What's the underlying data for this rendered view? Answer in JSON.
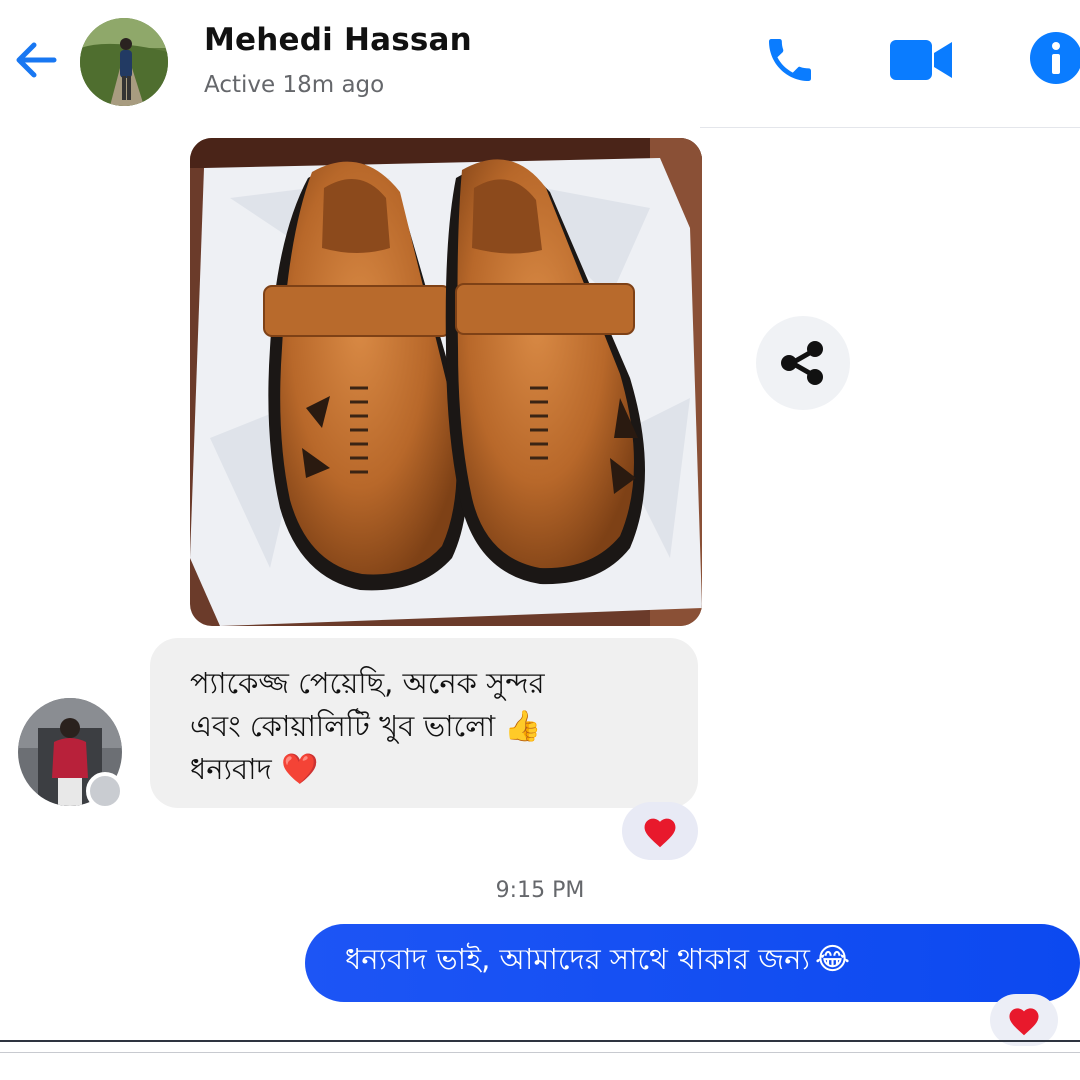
{
  "header": {
    "name": "Mehedi Hassan",
    "status": "Active 18m ago",
    "back_icon": "arrow-left-icon",
    "call_icon": "phone-icon",
    "video_icon": "video-camera-icon",
    "info_icon": "info-icon"
  },
  "messages": {
    "photo": {
      "type": "image",
      "subject": "brown-leather-shoes-in-box"
    },
    "share_icon": "share-icon",
    "incoming": {
      "line1": "প্যাকেজ্জ পেয়েছি, অনেক সুন্দর",
      "line2": "এবং কোয়ালিটি খুব ভালো",
      "line2_emoji": "👍",
      "line3": "ধন্যবাদ",
      "line3_emoji": "❤️",
      "reaction": "❤️"
    },
    "timestamp": "9:15 PM",
    "outgoing": {
      "text": "ধন্যবাদ ভাই, আমাদের সাথে থাকার জন্য",
      "emoji": "😂",
      "reaction": "❤️"
    }
  },
  "colors": {
    "accent": "#0a7cff",
    "outgoing_bubble": "#1450f5",
    "incoming_bubble": "#f0f0f0",
    "heart": "#e8192c"
  }
}
